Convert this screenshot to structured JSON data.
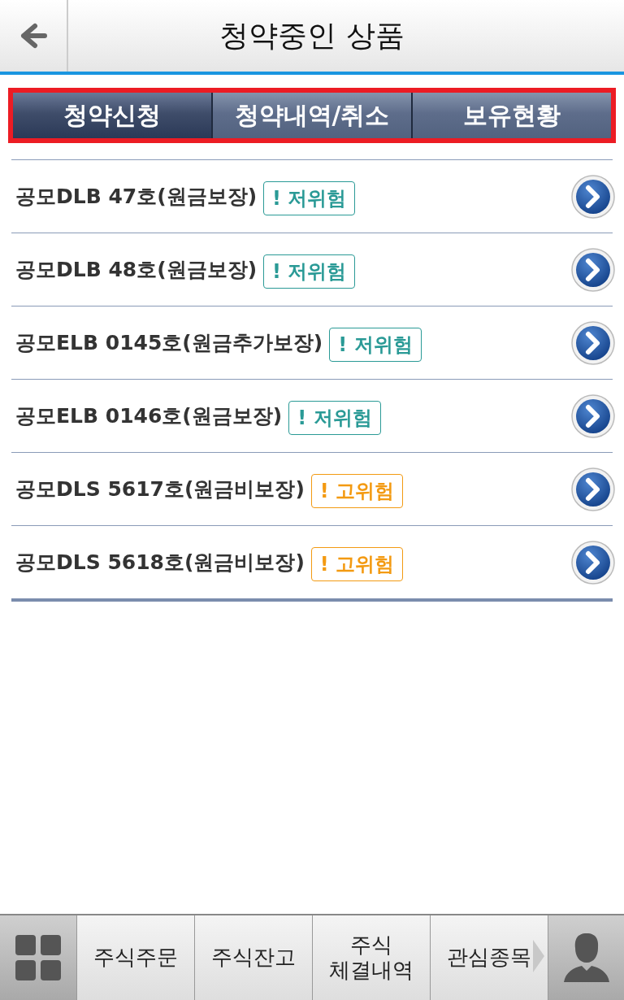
{
  "header": {
    "title": "청약중인 상품"
  },
  "tabs": [
    {
      "label": "청약신청",
      "selected": true
    },
    {
      "label": "청약내역/취소",
      "selected": false
    },
    {
      "label": "보유현황",
      "selected": false
    }
  ],
  "products": [
    {
      "name": "공모DLB 47호(원금보장)",
      "risk": "! 저위험",
      "kind": "low"
    },
    {
      "name": "공모DLB 48호(원금보장)",
      "risk": "! 저위험",
      "kind": "low"
    },
    {
      "name": "공모ELB 0145호(원금추가보장)",
      "risk": "! 저위험",
      "kind": "low"
    },
    {
      "name": "공모ELB 0146호(원금보장)",
      "risk": "! 저위험",
      "kind": "low"
    },
    {
      "name": "공모DLS 5617호(원금비보장)",
      "risk": "! 고위험",
      "kind": "high"
    },
    {
      "name": "공모DLS 5618호(원금비보장)",
      "risk": "! 고위험",
      "kind": "high"
    }
  ],
  "bottom_bar": {
    "items": [
      "주식주문",
      "주식잔고",
      "주식\n체결내역",
      "관심종목"
    ]
  }
}
